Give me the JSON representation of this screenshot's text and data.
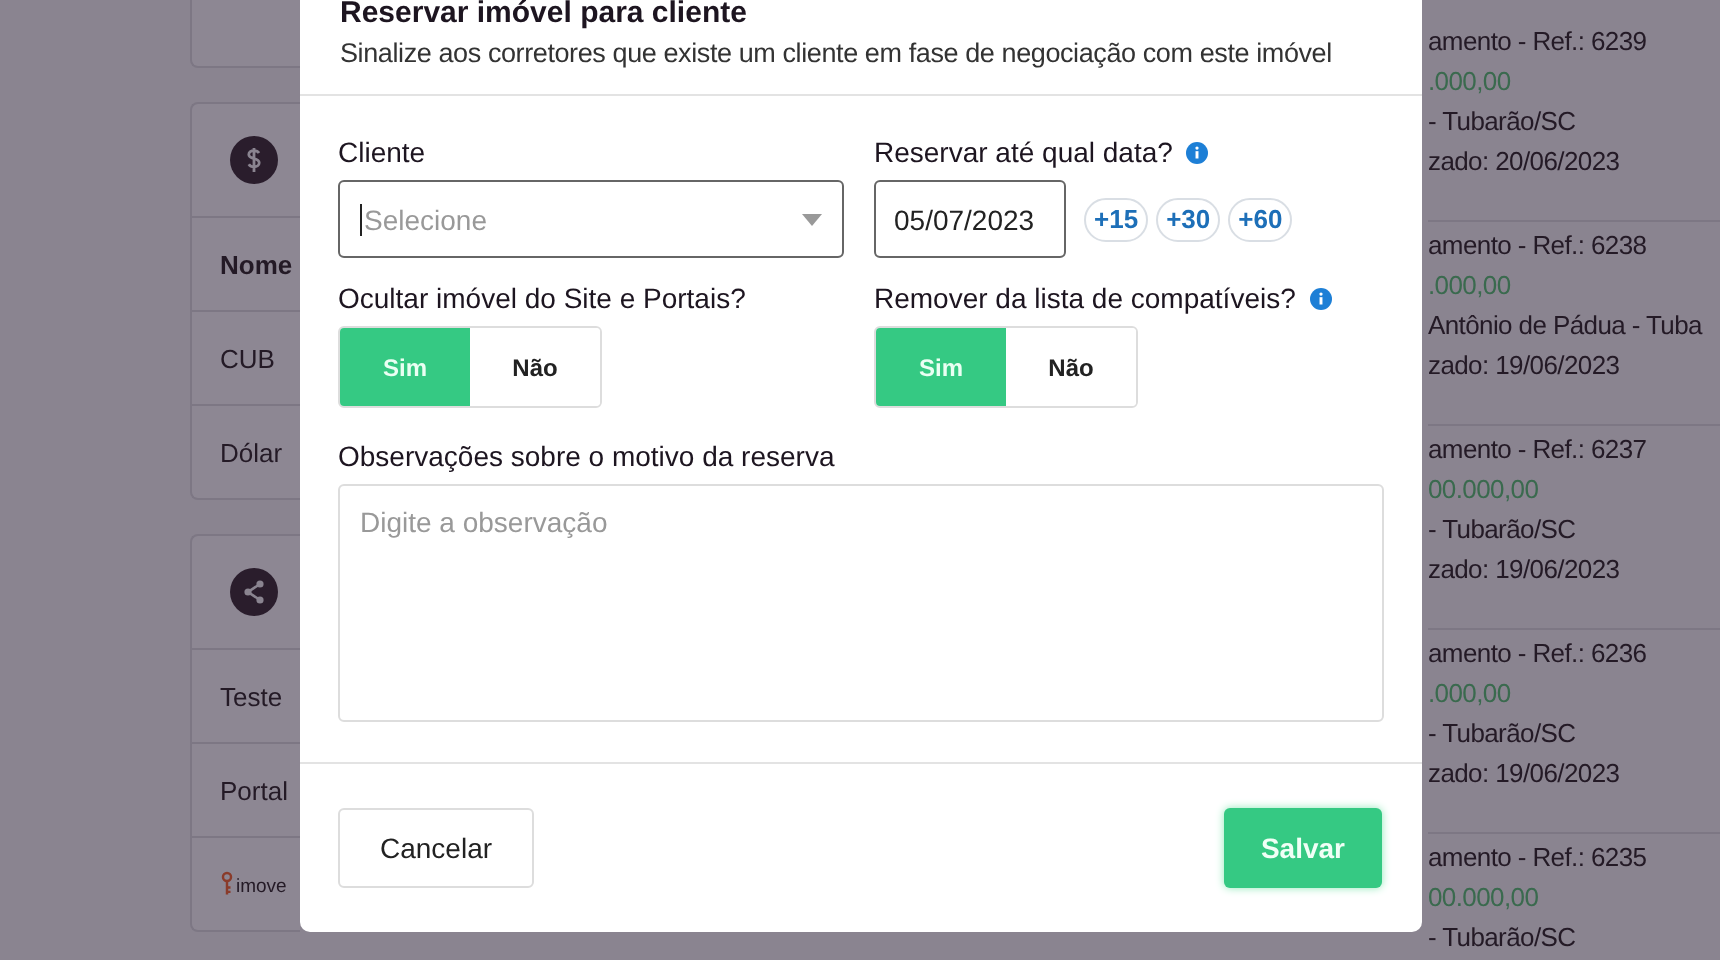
{
  "background": {
    "cards": [
      {
        "rows": [
          {
            "kind": "header",
            "text": "Nome"
          },
          {
            "kind": "row",
            "text": "CUB"
          },
          {
            "kind": "row",
            "text": "Dólar"
          }
        ]
      },
      {
        "rows": [
          {
            "kind": "row",
            "text": "Teste"
          },
          {
            "kind": "row",
            "text": "Portal"
          },
          {
            "kind": "logo",
            "text": "imove"
          }
        ]
      }
    ],
    "listings": [
      {
        "title": "amento - Ref.: 6239",
        "price": ".000,00",
        "location": "- Tubarão/SC",
        "updated": "zado: 20/06/2023"
      },
      {
        "title": "amento - Ref.: 6238",
        "price": ".000,00",
        "location": "Antônio de Pádua - Tuba",
        "updated": "zado: 19/06/2023"
      },
      {
        "title": "amento - Ref.: 6237",
        "price": "00.000,00",
        "location": "- Tubarão/SC",
        "updated": "zado: 19/06/2023"
      },
      {
        "title": "amento - Ref.: 6236",
        "price": ".000,00",
        "location": "- Tubarão/SC",
        "updated": "zado: 19/06/2023"
      },
      {
        "title": "amento - Ref.: 6235",
        "price": "00.000,00",
        "location": "- Tubarão/SC"
      }
    ]
  },
  "modal": {
    "title": "Reservar imóvel para cliente",
    "subtitle": "Sinalize aos corretores que existe um cliente em fase de negociação com este imóvel",
    "client": {
      "label": "Cliente",
      "placeholder": "Selecione"
    },
    "date": {
      "label": "Reservar até qual data?",
      "value": "05/07/2023",
      "shortcuts": [
        "+15",
        "+30",
        "+60"
      ]
    },
    "toggles": [
      {
        "label": "Ocultar imóvel do Site e Portais?",
        "info": false,
        "options": [
          {
            "label": "Sim",
            "selected": true
          },
          {
            "label": "Não",
            "selected": false
          }
        ]
      },
      {
        "label": "Remover da lista de compatíveis?",
        "info": true,
        "options": [
          {
            "label": "Sim",
            "selected": true
          },
          {
            "label": "Não",
            "selected": false
          }
        ]
      }
    ],
    "notes": {
      "label": "Observações sobre o motivo da reserva",
      "placeholder": "Digite a observação"
    },
    "buttons": {
      "cancel": "Cancelar",
      "save": "Salvar"
    }
  }
}
